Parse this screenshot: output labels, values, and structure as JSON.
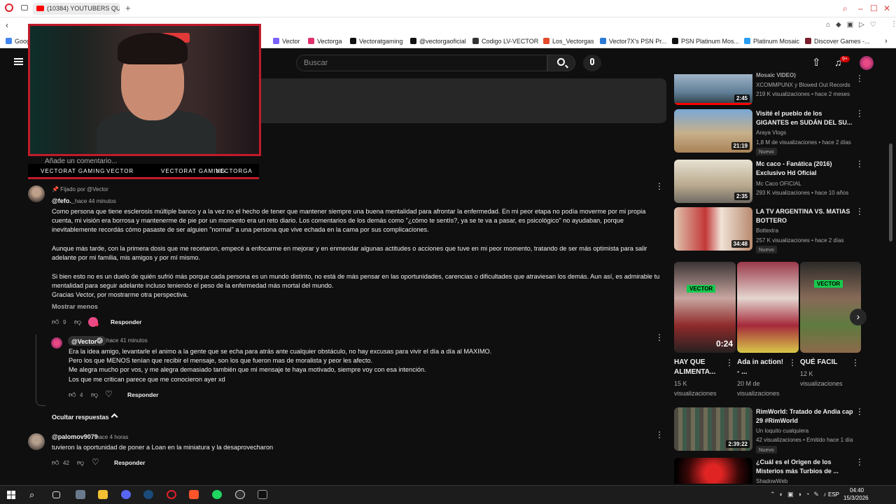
{
  "browser": {
    "tab_title": "(10384) YOUTUBERS QUE",
    "new_tab": "+",
    "bookmarks": [
      {
        "label": "Goog",
        "color": "#4285f4"
      },
      {
        "label": "Vector",
        "color": "#7b61ff"
      },
      {
        "label": "Vectorga",
        "color": "#e1306c"
      },
      {
        "label": "Vectoratgaming",
        "color": "#111111"
      },
      {
        "label": "@vectorgaoficial",
        "color": "#111111"
      },
      {
        "label": "Codigo LV-VECTOR",
        "color": "#333333"
      },
      {
        "label": "Los_Vectorgas",
        "color": "#e24a2b"
      },
      {
        "label": "Vector7X's PSN Pr...",
        "color": "#2a7ad5"
      },
      {
        "label": "PSN Platinum Mos...",
        "color": "#111111"
      },
      {
        "label": "Platinum Mosaic",
        "color": "#2a9df4"
      },
      {
        "label": "Discover Games -...",
        "color": "#7a1f2e"
      }
    ]
  },
  "youtube": {
    "search_placeholder": "Buscar",
    "notif_count": "9+",
    "add_comment_placeholder": "Añade un comentario...",
    "pinned_label": "Fijado por @Vector",
    "comments": [
      {
        "handle": "@fefo._",
        "time": "hace 44 minutos",
        "lines": [
          "Como persona que tiene esclerosis múltiple banco y a la vez no el hecho de tener que mantener siempre una buena mentalidad para afrontar la enfermedad. En mi peor etapa no podía moverme por mi propia",
          "cuenta, mi visión era borrosa y mantenerme de pie por un momento era un reto diario. Los comentarios de los demás como \"¿cómo te sentís?, ya se te va a pasar, es psicológico\" no ayudaban, porque",
          "inevitablemente recordás cómo pasaste de ser alguien \"normal\" a una persona que vive echada en la cama por sus complicaciones.",
          "",
          "Aunque más tarde, con la primera dosis que me recetaron, empecé a enfocarme en mejorar y en enmendar algunas actitudes o acciones que tuve en mi peor momento, tratando de ser más optimista para salir",
          "adelante por mi familia, mis amigos y por mí mismo.",
          "",
          "Si bien esto no es un duelo de quién sufrió más porque cada persona es un mundo distinto, no está de más pensar en las oportunidades, carencias o dificultades que atraviesan los demás. Aun así, es admirable tu",
          "mentalidad para seguir adelante incluso teniendo el peso de la enfermedad más mortal del mundo.",
          "Gracias Vector, por mostrarme otra perspectiva."
        ],
        "show_less": "Mostrar menos",
        "likes": "9",
        "reply": "Responder"
      },
      {
        "handle": "@Vector",
        "time": "hace 41 minutos",
        "lines": [
          "Era la idea amigo, levantarle el animo a la gente que se echa para atrás ante cualquier obstáculo, no hay excusas para vivir el día a día al MAXIMO.",
          "Pero los que MENOS tenían que recibir el mensaje, son los que fueron mas de moralista y peor les afecto.",
          "Me alegra mucho por vos, y me alegra demasiado también que mi mensaje te haya motivado, siempre voy con esa intención.",
          "Los que me critican parece que me conocieron ayer xd"
        ],
        "likes": "4",
        "reply": "Responder"
      },
      {
        "handle": "@palomov9079",
        "time": "hace 4 horas",
        "lines": [
          "tuvieron la oportunidad de poner a Loan en la miniatura y la desaprovecharon"
        ],
        "likes": "42",
        "reply": "Responder"
      }
    ],
    "hide_replies": "Ocultar respuestas",
    "social_overlay": [
      "VECTORAT GAMING",
      "VECTOR",
      "VECTORAT GAMING",
      "VECTORGA"
    ],
    "related": [
      {
        "title": "Mosaic VIDEO)",
        "channel": "XCOMMPUNX y Blowed Out Records",
        "stats": "219 K visualizaciones • hace 2 meses",
        "duration": "2:45",
        "badge": ""
      },
      {
        "title": "Visité el pueblo de los GIGANTES en SUDÁN DEL SU...",
        "channel": "Araya Vlogs",
        "stats": "1,8 M de visualizaciones • hace 2 días",
        "duration": "21:19",
        "badge": "Nuevo"
      },
      {
        "title": "Mc caco - Fanática (2016) Exclusivo Hd Oficial",
        "channel": "Mc Caco OFICIAL",
        "stats": "293 K visualizaciones • hace 10 años",
        "duration": "2:35",
        "badge": ""
      },
      {
        "title": "LA TV ARGENTINA VS. MATIAS BOTTERO",
        "channel": "Bottextra",
        "stats": "257 K visualizaciones • hace 2 días",
        "duration": "34:48",
        "badge": "Nuevo"
      },
      {
        "title": "RimWorld: Tratado de Andia cap 29 #RimWorld",
        "channel": "Un loquito cualquiera",
        "stats": "42 visualizaciones • Emitido hace 1 día",
        "duration": "2:39:22",
        "badge": "Nuevo"
      },
      {
        "title": "¿Cuál es el Origen de los Misterios más Turbios de ...",
        "channel": "ShadowWeb",
        "stats": "",
        "duration": "",
        "badge": ""
      }
    ],
    "shorts": [
      {
        "title": "HAY QUE ALIMENTA...",
        "views": "15 K visualizaciones",
        "duration": "0:24",
        "tag": "VECTOR"
      },
      {
        "title": "Ada in action! - ...",
        "views": "20 M de visualizaciones",
        "duration": "",
        "tag": ""
      },
      {
        "title": "QUÉ FACIL",
        "views": "12 K visualizaciones",
        "duration": "",
        "tag": "VECTOR"
      }
    ]
  },
  "taskbar": {
    "lang": "ESP",
    "time": "04:40",
    "date": "15/3/2026"
  },
  "colors": {
    "youtube_red": "#ff0000",
    "overlay_red": "#c21a2a",
    "dark_bg": "#0f0f0f"
  }
}
